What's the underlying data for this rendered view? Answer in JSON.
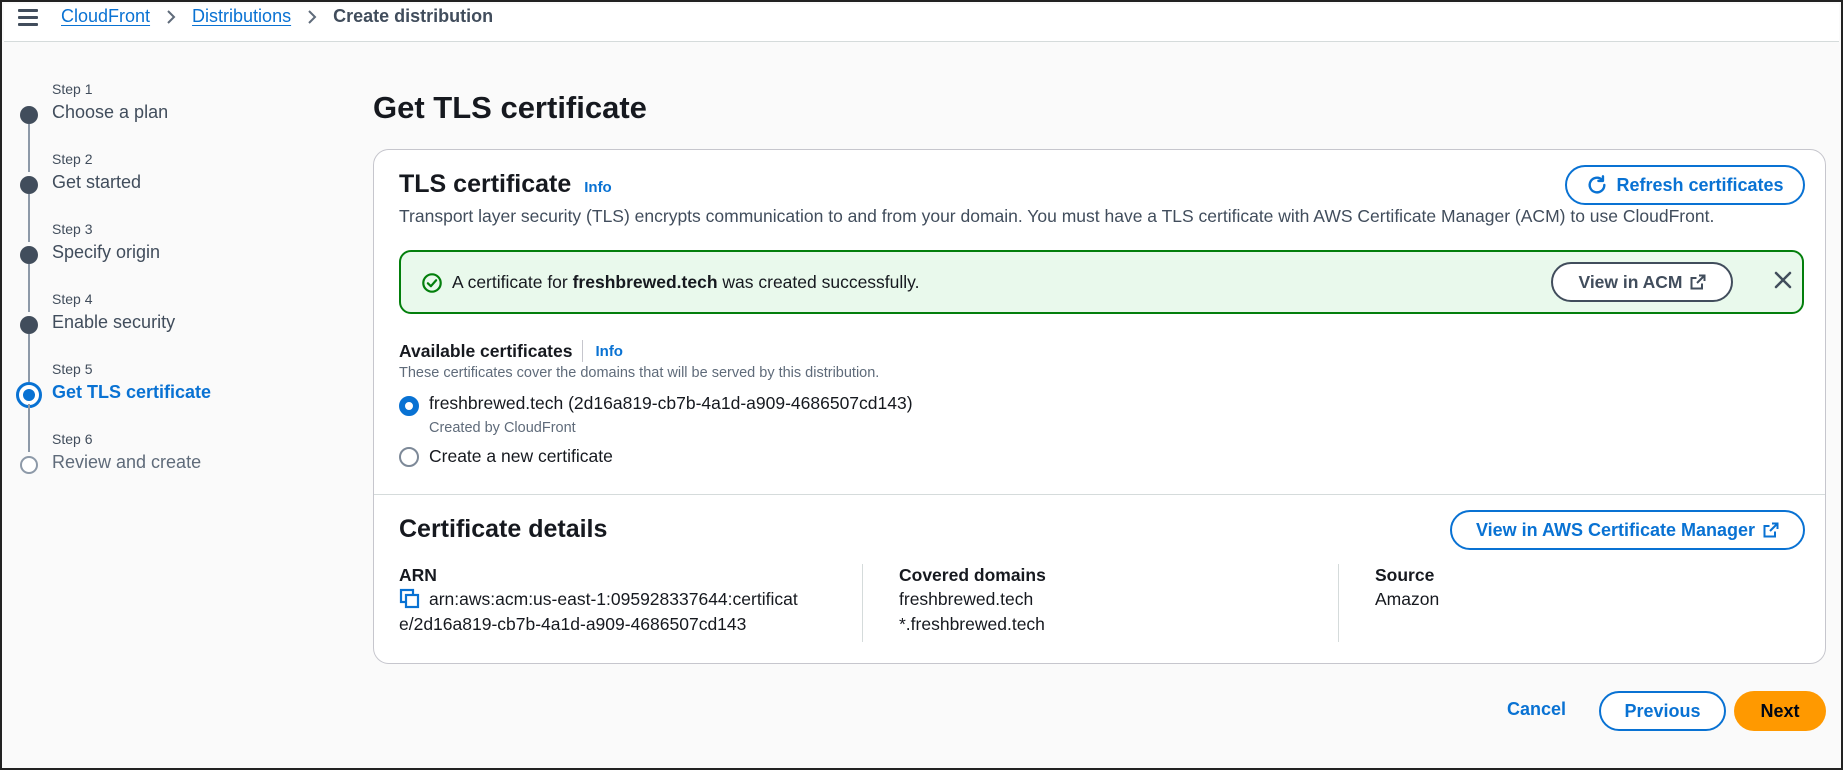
{
  "breadcrumb": {
    "items": [
      "CloudFront",
      "Distributions"
    ],
    "current": "Create distribution"
  },
  "steps": [
    {
      "num": "Step 1",
      "title": "Choose a plan",
      "state": "done"
    },
    {
      "num": "Step 2",
      "title": "Get started",
      "state": "done"
    },
    {
      "num": "Step 3",
      "title": "Specify origin",
      "state": "done"
    },
    {
      "num": "Step 4",
      "title": "Enable security",
      "state": "done"
    },
    {
      "num": "Step 5",
      "title": "Get TLS certificate",
      "state": "active"
    },
    {
      "num": "Step 6",
      "title": "Review and create",
      "state": "pending"
    }
  ],
  "page": {
    "title": "Get TLS certificate"
  },
  "tls": {
    "title": "TLS certificate",
    "info": "Info",
    "refresh_label": "Refresh certificates",
    "description": "Transport layer security (TLS) encrypts communication to and from your domain. You must have a TLS certificate with AWS Certificate Manager (ACM) to use CloudFront.",
    "flash": {
      "prefix": "A certificate for ",
      "domain": "freshbrewed.tech",
      "suffix": " was created successfully.",
      "button": "View in ACM"
    },
    "available": {
      "label": "Available certificates",
      "info": "Info",
      "description": "These certificates cover the domains that will be served by this distribution.",
      "options": [
        {
          "label": "freshbrewed.tech (2d16a819-cb7b-4a1d-a909-4686507cd143)",
          "sub": "Created by CloudFront",
          "checked": true
        },
        {
          "label": "Create a new certificate",
          "sub": "",
          "checked": false
        }
      ]
    }
  },
  "details": {
    "title": "Certificate details",
    "acm_button": "View in AWS Certificate Manager",
    "arn_label": "ARN",
    "arn_line1": "arn:aws:acm:us-east-1:095928337644:certificat",
    "arn_line2": "e/2d16a819-cb7b-4a1d-a909-4686507cd143",
    "domains_label": "Covered domains",
    "domains": [
      "freshbrewed.tech",
      "*.freshbrewed.tech"
    ],
    "source_label": "Source",
    "source": "Amazon"
  },
  "footer": {
    "cancel": "Cancel",
    "previous": "Previous",
    "next": "Next"
  },
  "colors": {
    "link": "#0972d3",
    "primary": "#ff9900",
    "success_bg": "#e9f9ec",
    "success_border": "#037f0c"
  }
}
